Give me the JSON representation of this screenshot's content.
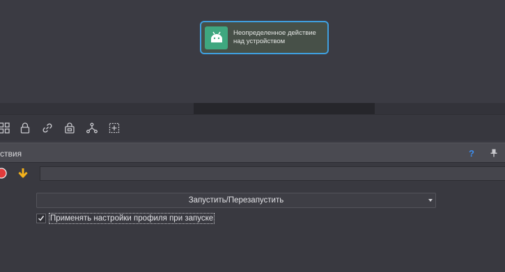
{
  "canvas": {
    "node": {
      "line1": "Неопределенное действие",
      "line2": "над устройством",
      "icon": "android-icon"
    }
  },
  "toolbar": {
    "icons": [
      "grid-icon",
      "lock-icon",
      "link-icon",
      "device-lock-icon",
      "hierarchy-icon",
      "add-frame-icon"
    ]
  },
  "panel": {
    "title": "ствия",
    "help": "?"
  },
  "action": {
    "name_value": "",
    "mode_select": "Запустить/Перезапустить",
    "apply_profile_label": "Применять настройки профиля при запуске",
    "apply_profile_checked": true
  },
  "colors": {
    "accent": "#3fa0e0",
    "android": "#3fa77f",
    "arrow": "#f4b21b",
    "stop": "#e23b3b",
    "help": "#3d8ef0"
  }
}
